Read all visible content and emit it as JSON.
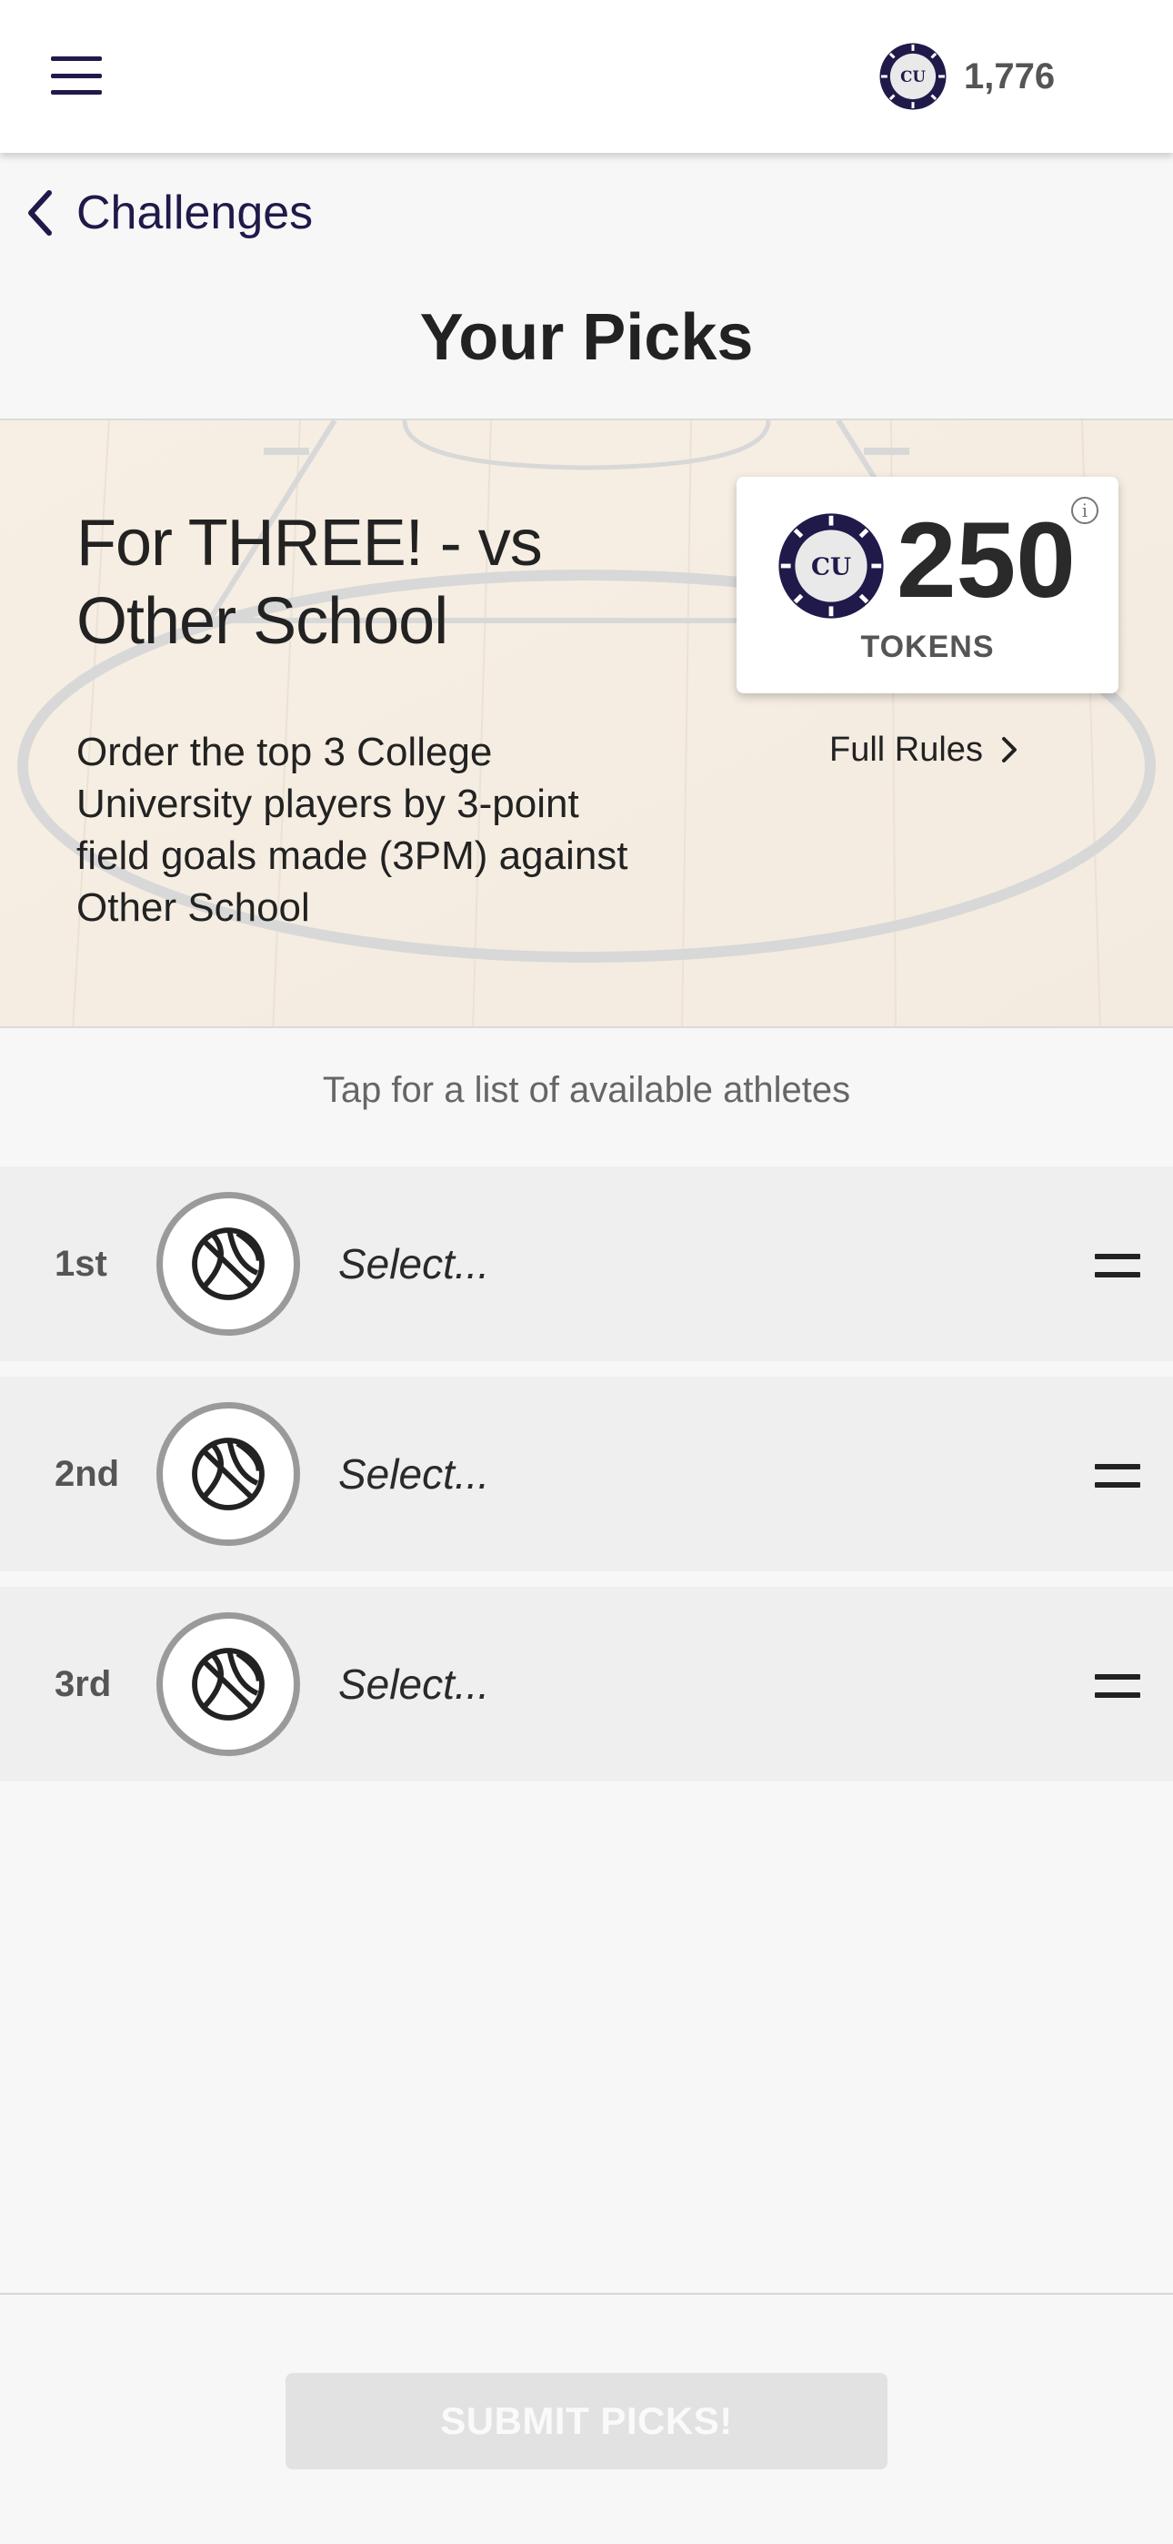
{
  "header": {
    "menu_icon": "hamburger-icon",
    "coin_label": "CU",
    "balance": "1,776"
  },
  "nav": {
    "back_label": "Challenges"
  },
  "page": {
    "title": "Your Picks"
  },
  "challenge": {
    "title": "For THREE! - vs Other School",
    "description": "Order the top 3 College University players by 3-point field goals made (3PM) against Other School",
    "tokens": "250",
    "tokens_unit": "TOKENS",
    "coin_label": "CU",
    "info_glyph": "i",
    "full_rules_label": "Full Rules"
  },
  "picks": {
    "hint": "Tap for a list of available athletes",
    "rows": [
      {
        "rank": "1st",
        "placeholder": "Select..."
      },
      {
        "rank": "2nd",
        "placeholder": "Select..."
      },
      {
        "rank": "3rd",
        "placeholder": "Select..."
      }
    ]
  },
  "footer": {
    "submit_label": "SUBMIT PICKS!"
  },
  "colors": {
    "brand_navy": "#1f1a4a",
    "banner_bg": "#f5eee5",
    "row_bg": "#efefef",
    "submit_disabled": "#e2e2e2"
  }
}
